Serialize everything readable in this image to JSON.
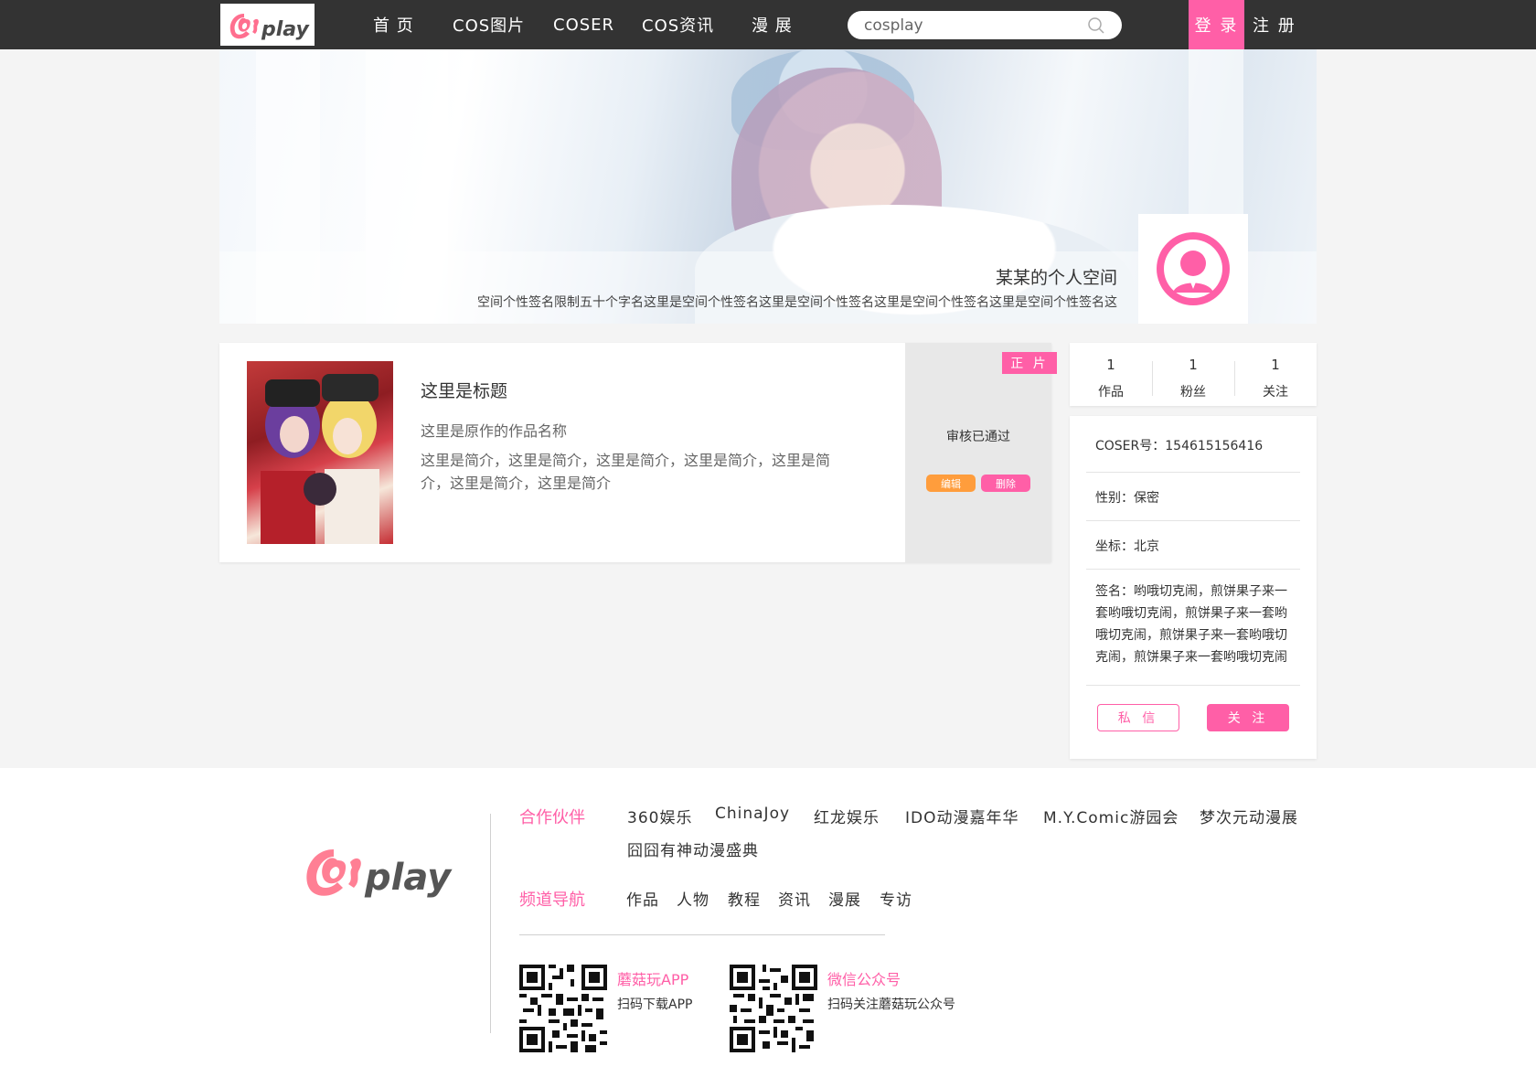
{
  "header": {
    "logo_text": "cosplay",
    "nav": [
      "首 页",
      "COS图片",
      "COSER",
      "COS资讯",
      "漫 展"
    ],
    "search_value": "cosplay",
    "login_label": "登 录",
    "register_label": "注 册"
  },
  "banner": {
    "space_title": "某某的个人空间",
    "signature": "空间个性签名限制五十个字名这里是空间个性签名这里是空间个性签名这里是空间个性签名这里是空间个性签名这"
  },
  "work": {
    "badge": "正 片",
    "title": "这里是标题",
    "origin": "这里是原作的作品名称",
    "intro": "这里是简介，这里是简介，这里是简介，这里是简介，这里是简介，这里是简介，这里是简介",
    "status": "审核已通过",
    "edit_label": "编辑",
    "delete_label": "删除"
  },
  "stats": [
    {
      "value": "1",
      "label": "作品"
    },
    {
      "value": "1",
      "label": "粉丝"
    },
    {
      "value": "1",
      "label": "关注"
    }
  ],
  "profile": {
    "coser_id": "COSER号：154615156416",
    "gender": "性别：保密",
    "location": "坐标：北京",
    "sign": "签名：哟哦切克闹，煎饼果子来一套哟哦切克闹，煎饼果子来一套哟哦切克闹，煎饼果子来一套哟哦切克闹，煎饼果子来一套哟哦切克闹",
    "message_label": "私 信",
    "follow_label": "关 注"
  },
  "footer": {
    "partners_heading": "合作伙伴",
    "partners": [
      "360娱乐",
      "ChinaJoy",
      "红龙娱乐",
      "IDO动漫嘉年华",
      "M.Y.Comic游园会",
      "梦次元动漫展",
      "囧囧有神动漫盛典"
    ],
    "channels_heading": "频道导航",
    "channels": [
      "作品",
      "人物",
      "教程",
      "资讯",
      "漫展",
      "专访"
    ],
    "app_title": "蘑菇玩APP",
    "app_desc": "扫码下载APP",
    "wechat_title": "微信公众号",
    "wechat_desc": "扫码关注蘑菇玩公众号"
  },
  "colors": {
    "accent": "#ff5fa7",
    "edit": "#ff9d3c",
    "header_bg": "#333333"
  }
}
